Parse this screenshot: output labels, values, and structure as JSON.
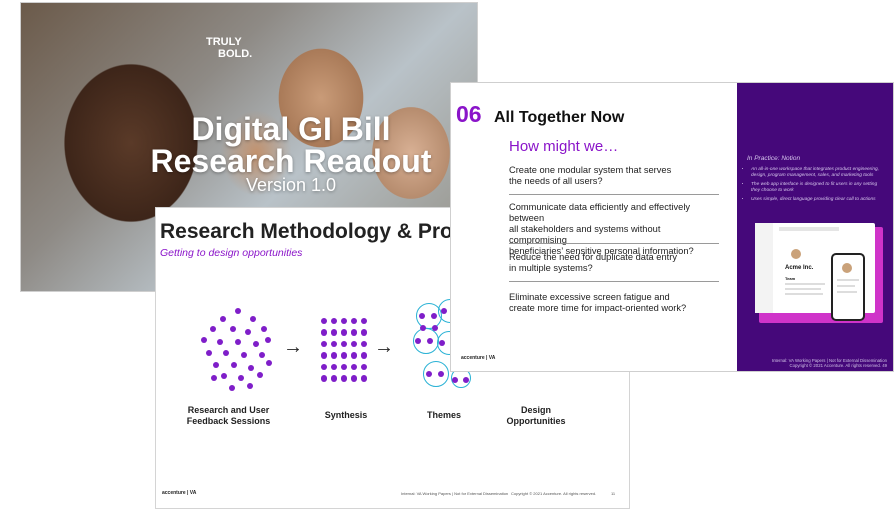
{
  "slide1": {
    "brand_line1": "TRULY",
    "brand_line2": "BOLD.",
    "title_line1": "Digital GI Bill",
    "title_line2": "Research Readout",
    "version": "Version 1.0"
  },
  "slide2": {
    "title": "Research Methodology & Pro",
    "subtitle": "Getting to design opportunities",
    "arrow": "→",
    "stages": [
      {
        "line1": "Research and User",
        "line2": "Feedback Sessions"
      },
      {
        "line1": "Synthesis",
        "line2": ""
      },
      {
        "line1": "Themes",
        "line2": ""
      },
      {
        "line1": "Design",
        "line2": "Opportunities"
      }
    ],
    "footer_logo": "accenture | VA",
    "footer_note": "Internal: VA Working Papers | Not for External Dissemination",
    "footer_copyright": "Copyright © 2021 Accenture. All rights reserved.",
    "page_number": "11"
  },
  "slide3": {
    "number": "06",
    "title": "All Together Now",
    "how_might_we": "How might we…",
    "questions": [
      {
        "line1": "Create one modular system that serves",
        "line2": "the needs of all users?",
        "line3": ""
      },
      {
        "line1": "Communicate data efficiently and effectively between",
        "line2": "all stakeholders and systems without compromising",
        "line3": "beneficiaries’ sensitive personal information?"
      },
      {
        "line1": "Reduce the need for duplicate data entry",
        "line2": "in multiple systems?",
        "line3": ""
      },
      {
        "line1": "Eliminate excessive screen fatigue and",
        "line2": "create more time for impact-oriented work?",
        "line3": ""
      }
    ],
    "footer_logo": "accenture | VA",
    "panel_title": "In Practice: Notion",
    "panel_bullets": [
      "An all-in-one workspace that integrates product engineering, design, program management, sales, and marketing tools",
      "The web app interface is designed to fit users in any setting they choose to work",
      "Uses simple, direct language providing clear call to actions"
    ],
    "mock_company": "Acme Inc.",
    "mock_section": "Team",
    "panel_footer_line1": "Internal: VA Working Papers | Not for External Dissemination",
    "panel_footer_line2": "Copyright © 2021 Accenture. All rights reserved.",
    "panel_page_number": "49"
  },
  "colors": {
    "accent_purple": "#8a14c9",
    "dot_purple": "#7f1ec9",
    "ring_cyan": "#2ab2d5",
    "panel_purple": "#45087a"
  }
}
